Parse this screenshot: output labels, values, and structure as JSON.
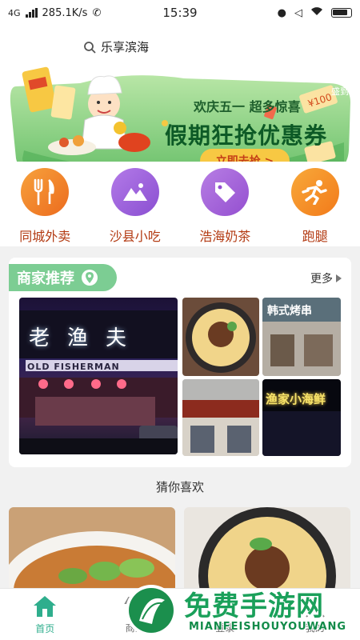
{
  "status_bar": {
    "network": "4G",
    "speed": "285.1K/s",
    "time": "15:39"
  },
  "header": {
    "location": "乐享滨海"
  },
  "banner": {
    "subtitle": "欢庆五一 超多惊喜",
    "title": "假期狂抢优惠券",
    "button_label": "立即去抢 >",
    "tag": "盛到"
  },
  "categories": [
    {
      "label": "同城外卖",
      "icon": "fork-knife-icon",
      "color": "#f08a22"
    },
    {
      "label": "沙县小吃",
      "icon": "mountain-icon",
      "color": "#9b5fd6"
    },
    {
      "label": "浩海奶茶",
      "icon": "tag-icon",
      "color": "#a35fd6"
    },
    {
      "label": "跑腿",
      "icon": "runner-icon",
      "color": "#f5901e"
    }
  ],
  "merchant_section": {
    "title": "商家推荐",
    "more_label": "更多",
    "featured_sign": "老渔夫",
    "featured_sign_en": "OLD FISHERMAN",
    "tile_sign_1": "韩式烤串",
    "tile_sign_2": "渔家小海鲜"
  },
  "guess_section": {
    "title": "猜你喜欢"
  },
  "tab_bar": {
    "tabs": [
      {
        "label": "首页",
        "active": true
      },
      {
        "label": "商家",
        "active": false
      },
      {
        "label": "登录",
        "active": false
      },
      {
        "label": "我的",
        "active": false
      }
    ]
  },
  "watermark": {
    "text": "免费手游网",
    "sub": "MIANFEISHOUYOUWANG"
  },
  "colors": {
    "accent": "#2fae8d",
    "banner_green": "#8fd28a",
    "category_label": "#b33a12",
    "section_tag": "#7ccd93"
  }
}
